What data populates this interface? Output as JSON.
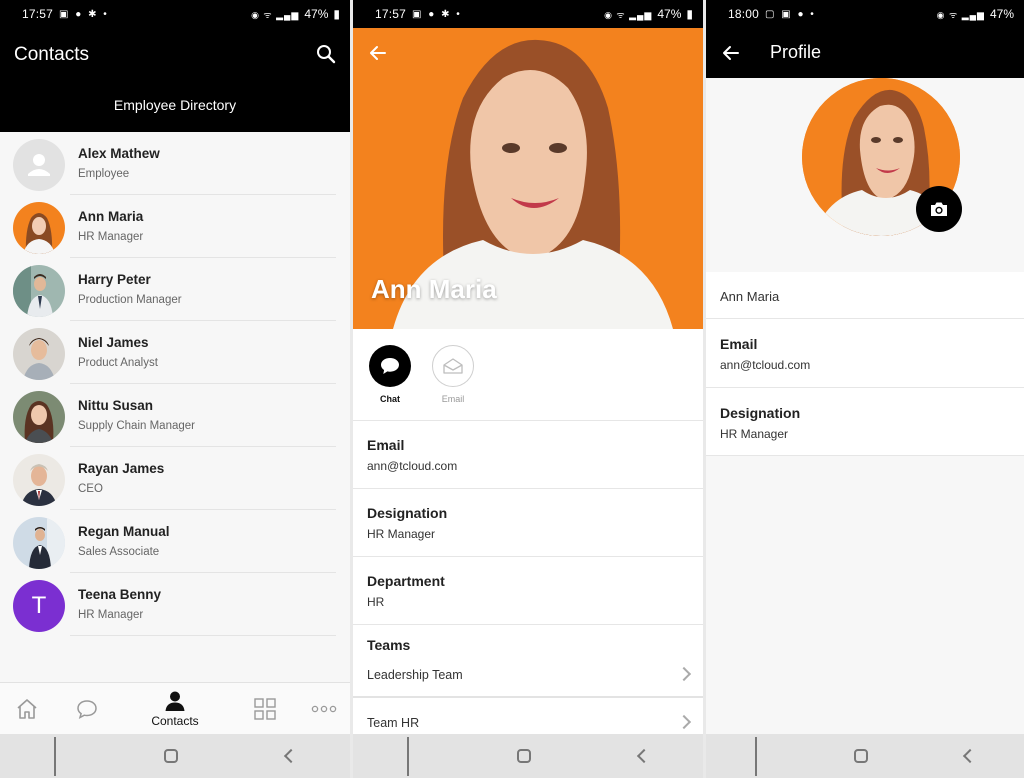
{
  "panel1": {
    "status": {
      "time": "17:57",
      "battery": "47%"
    },
    "header": {
      "title": "Contacts",
      "subtitle": "Employee Directory"
    },
    "contacts": [
      {
        "name": "Alex Mathew",
        "role": "Employee",
        "avatar": "placeholder-person-icon"
      },
      {
        "name": "Ann Maria",
        "role": "HR Manager",
        "avatar": "photo"
      },
      {
        "name": "Harry Peter",
        "role": "Production Manager",
        "avatar": "photo"
      },
      {
        "name": "Niel James",
        "role": "Product Analyst",
        "avatar": "photo"
      },
      {
        "name": "Nittu Susan",
        "role": "Supply Chain Manager",
        "avatar": "photo"
      },
      {
        "name": "Rayan James",
        "role": "CEO",
        "avatar": "photo"
      },
      {
        "name": "Regan Manual",
        "role": "Sales Associate",
        "avatar": "photo"
      },
      {
        "name": "Teena Benny",
        "role": "HR Manager",
        "avatar": "initial",
        "initial": "T"
      }
    ],
    "bottom_nav": {
      "active_label": "Contacts"
    }
  },
  "panel2": {
    "status": {
      "time": "17:57",
      "battery": "47%"
    },
    "hero_name": "Ann Maria",
    "actions": {
      "chat": "Chat",
      "email": "Email"
    },
    "email": {
      "label": "Email",
      "value": "ann@tcloud.com"
    },
    "designation": {
      "label": "Designation",
      "value": "HR Manager"
    },
    "department": {
      "label": "Department",
      "value": "HR"
    },
    "teams": {
      "label": "Teams",
      "items": [
        "Leadership Team",
        "Team HR"
      ]
    }
  },
  "panel3": {
    "status": {
      "time": "18:00",
      "battery": "47%"
    },
    "title": "Profile",
    "name": "Ann Maria",
    "email": {
      "label": "Email",
      "value": "ann@tcloud.com"
    },
    "designation": {
      "label": "Designation",
      "value": "HR Manager"
    }
  },
  "colors": {
    "accent_orange": "#f3821e",
    "header_black": "#000000",
    "avatar_purple": "#7b2fd1"
  }
}
